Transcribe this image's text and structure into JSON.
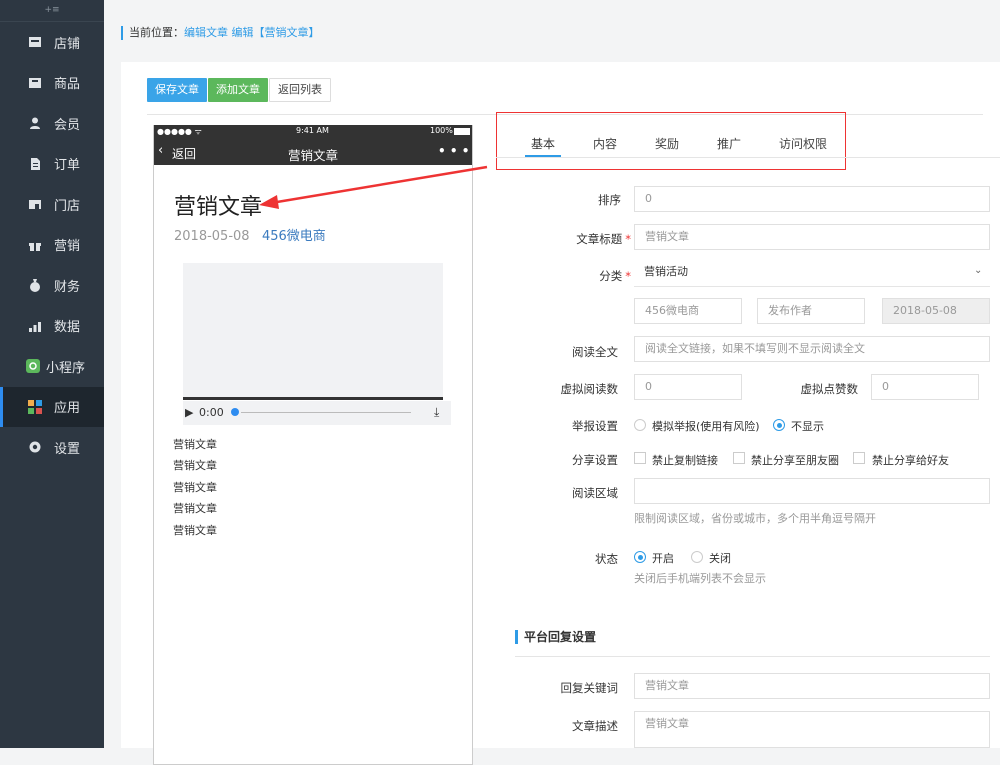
{
  "sidebar": {
    "toggle": "+≡",
    "items": [
      {
        "label": "店铺",
        "icon": "store-icon"
      },
      {
        "label": "商品",
        "icon": "goods-icon"
      },
      {
        "label": "会员",
        "icon": "member-icon"
      },
      {
        "label": "订单",
        "icon": "order-icon"
      },
      {
        "label": "门店",
        "icon": "shop-icon"
      },
      {
        "label": "营销",
        "icon": "gift-icon"
      },
      {
        "label": "财务",
        "icon": "money-bag-icon"
      },
      {
        "label": "数据",
        "icon": "bar-chart-icon"
      },
      {
        "label": "小程序",
        "icon": "miniprogram-icon"
      },
      {
        "label": "应用",
        "icon": "apps-icon"
      },
      {
        "label": "设置",
        "icon": "gear-icon"
      }
    ],
    "active_index": 9
  },
  "breadcrumb": {
    "prefix": "当前位置：",
    "path": "编辑文章 编辑【营销文章】"
  },
  "toolbar": {
    "save": "保存文章",
    "add": "添加文章",
    "back": "返回列表"
  },
  "phone": {
    "signal": "●●●●● ᯤ",
    "time": "9:41 AM",
    "battery": "100%",
    "back": "返回",
    "nav_title": "营销文章",
    "more": "• • •",
    "title": "营销文章",
    "date": "2018-05-08",
    "author": "456微电商",
    "play_time": "0:00",
    "list": [
      "营销文章",
      "营销文章",
      "营销文章",
      "营销文章",
      "营销文章"
    ]
  },
  "tabs": [
    "基本",
    "内容",
    "奖励",
    "推广",
    "访问权限"
  ],
  "form": {
    "sort_label": "排序",
    "sort_ph": "0",
    "title_label": "文章标题",
    "title_ph": "营销文章",
    "cat_label": "分类",
    "cat_value": "营销活动",
    "author_ph": "456微电商",
    "publisher_ph": "发布作者",
    "date_value": "2018-05-08",
    "readall_label": "阅读全文",
    "readall_ph": "阅读全文链接，如果不填写则不显示阅读全文",
    "vread_label": "虚拟阅读数",
    "vread_ph": "0",
    "vlike_label": "虚拟点赞数",
    "vlike_ph": "0",
    "report_label": "举报设置",
    "report_opt1": "模拟举报(使用有风险)",
    "report_opt2": "不显示",
    "share_label": "分享设置",
    "share_opt1": "禁止复制链接",
    "share_opt2": "禁止分享至朋友圈",
    "share_opt3": "禁止分享给好友",
    "area_label": "阅读区域",
    "area_help": "限制阅读区域，省份或城市，多个用半角逗号隔开",
    "status_label": "状态",
    "status_on": "开启",
    "status_off": "关闭",
    "status_help": "关闭后手机端列表不会显示",
    "reply_section": "平台回复设置",
    "kw_label": "回复关键词",
    "kw_ph": "营销文章",
    "desc_label": "文章描述",
    "desc_ph": "营销文章"
  }
}
